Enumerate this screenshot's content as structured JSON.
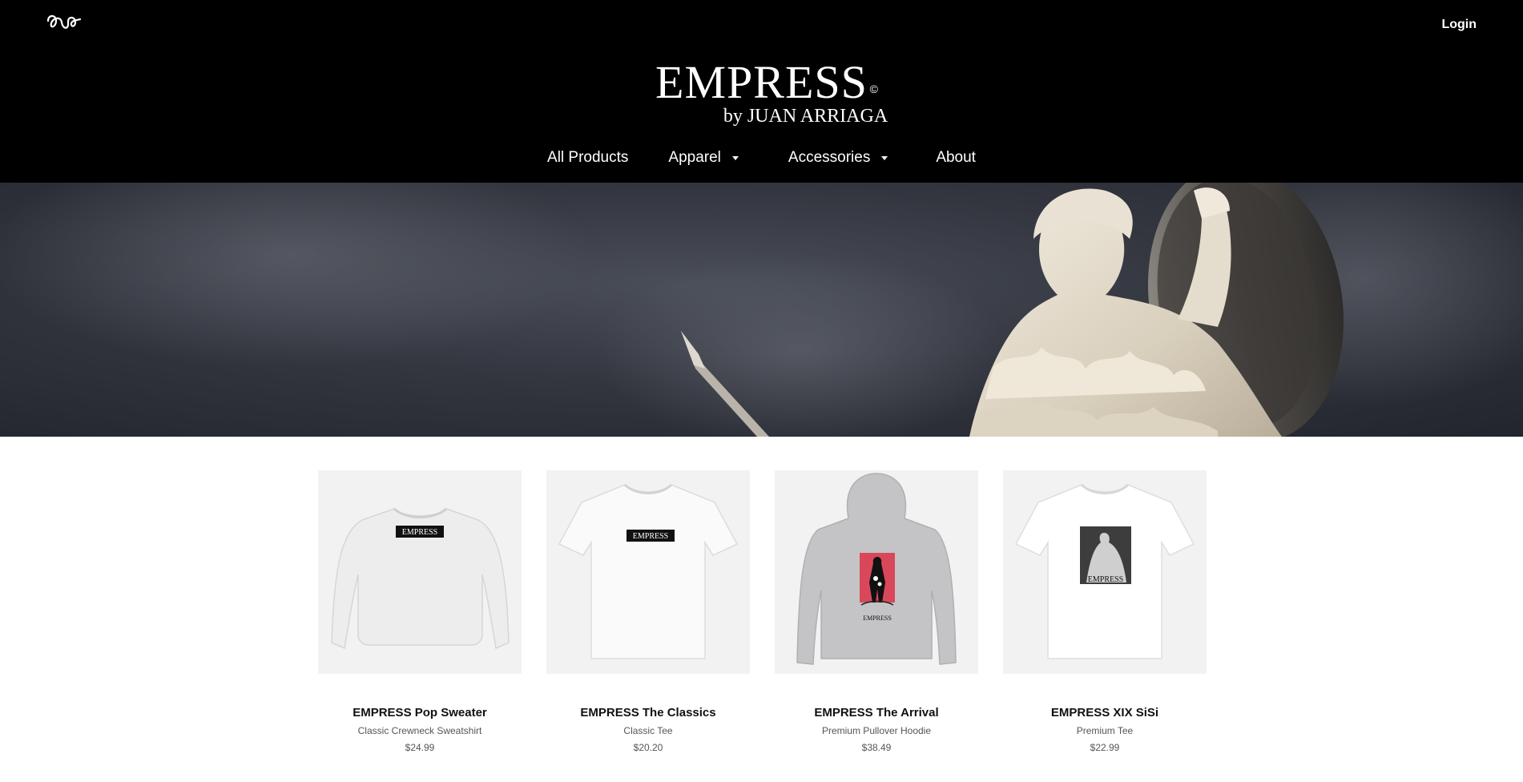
{
  "header": {
    "login_label": "Login",
    "brand_title": "EMPRESS",
    "brand_copyright": "©",
    "brand_subtitle": "by JUAN ARRIAGA"
  },
  "nav": [
    {
      "label": "All Products",
      "has_dropdown": false
    },
    {
      "label": "Apparel",
      "has_dropdown": true
    },
    {
      "label": "Accessories",
      "has_dropdown": true
    },
    {
      "label": "About",
      "has_dropdown": false
    }
  ],
  "hero": {
    "image": "statue-warrior-with-spear-and-shield"
  },
  "products": [
    {
      "name": "EMPRESS Pop Sweater",
      "type": "Classic Crewneck Sweatshirt",
      "price": "$24.99",
      "print_text": "EMPRESS"
    },
    {
      "name": "EMPRESS The Classics",
      "type": "Classic Tee",
      "price": "$20.20",
      "print_text": "EMPRESS"
    },
    {
      "name": "EMPRESS The Arrival",
      "type": "Premium Pullover Hoodie",
      "price": "$38.49",
      "print_text": "EMPRESS"
    },
    {
      "name": "EMPRESS XIX SiSi",
      "type": "Premium Tee",
      "price": "$22.99",
      "print_text": "EMPRESS"
    }
  ],
  "colors": {
    "header_bg": "#000000",
    "page_bg": "#ffffff",
    "card_bg": "#f2f2f3",
    "accent_red": "#d9485a"
  }
}
